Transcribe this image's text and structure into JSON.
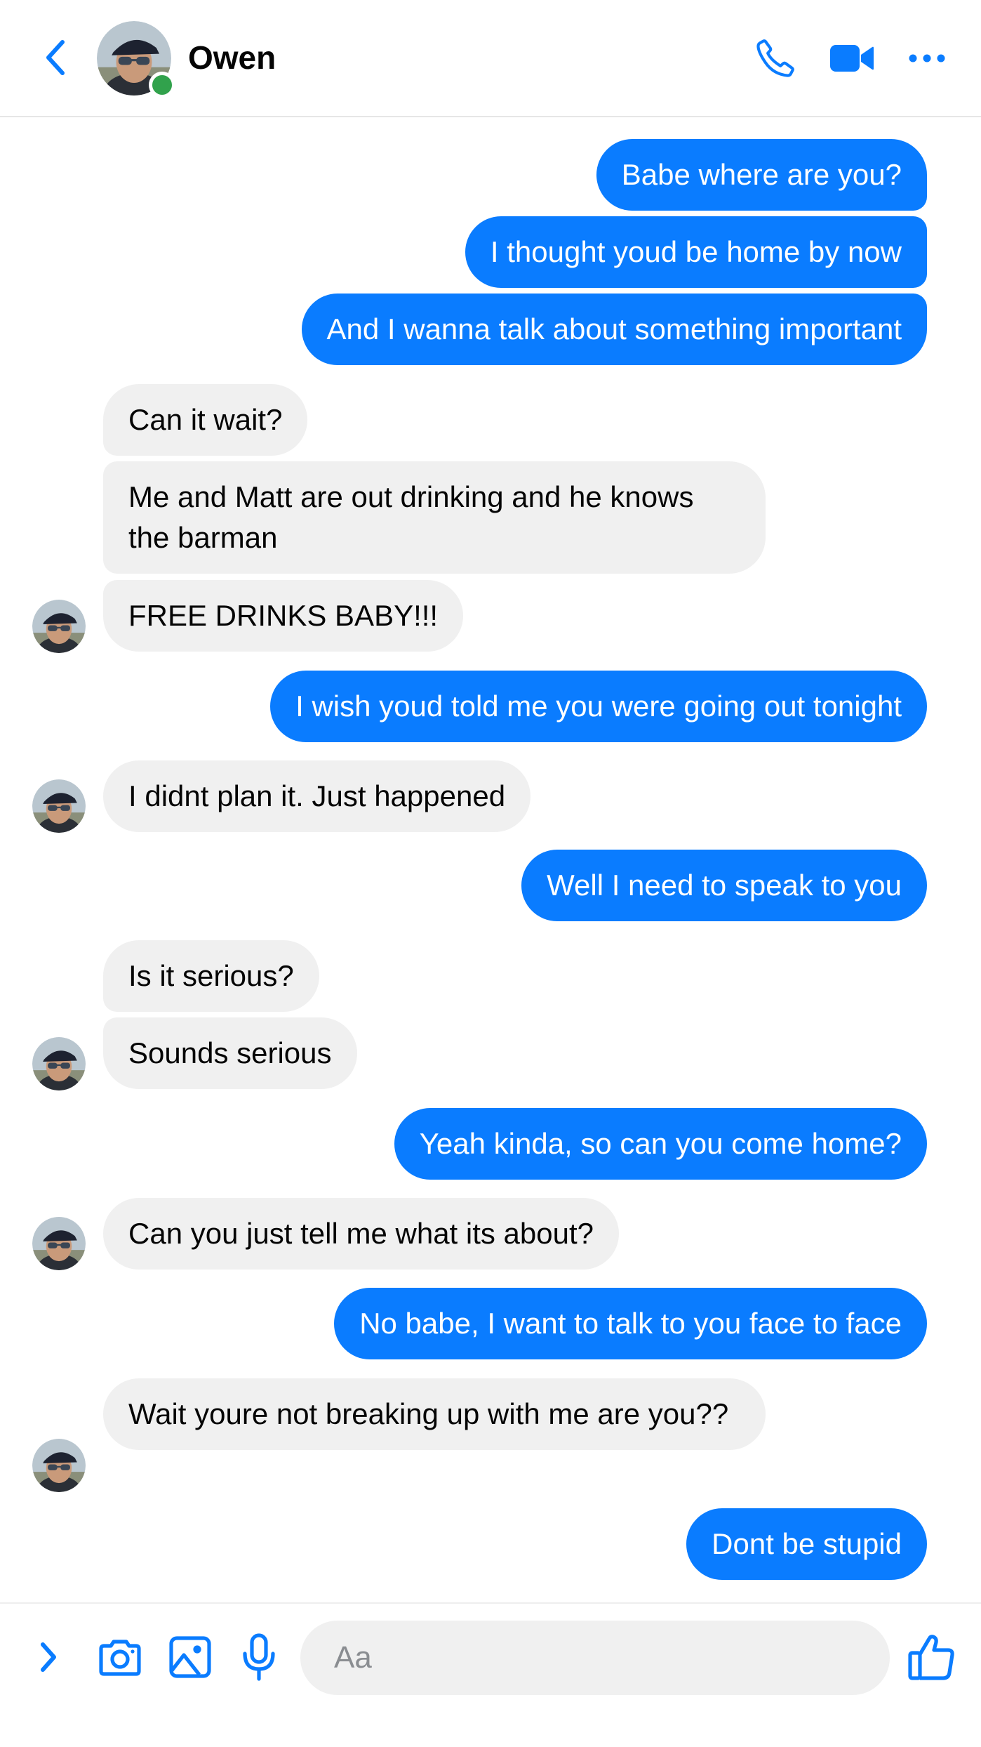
{
  "header": {
    "contact_name": "Owen",
    "online": true
  },
  "colors": {
    "accent": "#0a7cff",
    "incoming_bubble": "#f0f0f0",
    "online_dot": "#31a24c"
  },
  "icons": [
    "back-chevron-icon",
    "phone-icon",
    "video-camera-icon",
    "more-icon",
    "expand-chevron-icon",
    "camera-icon",
    "gallery-icon",
    "microphone-icon",
    "thumbs-up-icon"
  ],
  "messages": [
    {
      "from": "me",
      "text": "Babe where are you?"
    },
    {
      "from": "me",
      "text": "I thought youd be home by now"
    },
    {
      "from": "me",
      "text": "And I wanna talk about something important"
    },
    {
      "from": "owen",
      "text": "Can it wait?"
    },
    {
      "from": "owen",
      "text": "Me and Matt are out drinking and he knows the barman"
    },
    {
      "from": "owen",
      "text": "FREE DRINKS BABY!!!"
    },
    {
      "from": "me",
      "text": "I wish youd told me you were going out tonight"
    },
    {
      "from": "owen",
      "text": "I didnt plan it. Just happened"
    },
    {
      "from": "me",
      "text": "Well I need to speak to you"
    },
    {
      "from": "owen",
      "text": "Is it serious?"
    },
    {
      "from": "owen",
      "text": "Sounds serious"
    },
    {
      "from": "me",
      "text": "Yeah kinda, so can you come home?"
    },
    {
      "from": "owen",
      "text": "Can you just tell me what its about?"
    },
    {
      "from": "me",
      "text": "No babe, I want to talk to you face to face"
    },
    {
      "from": "owen",
      "text": "Wait youre not breaking up with me are you??"
    },
    {
      "from": "me",
      "text": "Dont be stupid"
    }
  ],
  "composer": {
    "placeholder": "Aa"
  }
}
